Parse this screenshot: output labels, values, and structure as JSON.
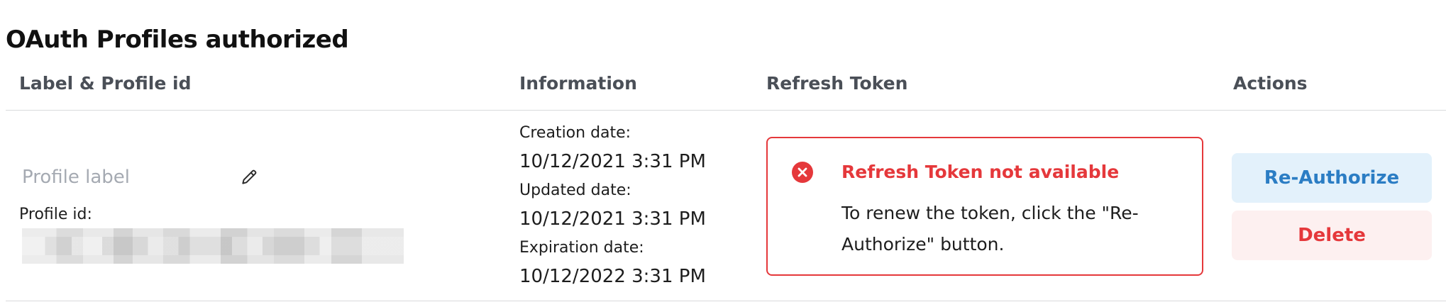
{
  "page": {
    "title": "OAuth Profiles authorized"
  },
  "table": {
    "headers": {
      "label": "Label & Profile id",
      "information": "Information",
      "refresh_token": "Refresh Token",
      "actions": "Actions"
    },
    "row": {
      "label_placeholder": "Profile label",
      "profile_id_label": "Profile id:",
      "profile_id_value": "",
      "info": {
        "creation_label": "Creation date:",
        "creation_value": "10/12/2021 3:31 PM",
        "updated_label": "Updated date:",
        "updated_value": "10/12/2021 3:31 PM",
        "expiration_label": "Expiration date:",
        "expiration_value": "10/12/2022 3:31 PM"
      },
      "refresh_token": {
        "icon": "error-circle-icon",
        "title": "Refresh Token not available",
        "message": "To renew the token, click the \"Re-Authorize\" button."
      },
      "actions": {
        "reauthorize_label": "Re-Authorize",
        "delete_label": "Delete"
      }
    }
  },
  "colors": {
    "error": "#e5383b",
    "primary": "#2b7dc4",
    "primary_bg": "#e3f1fb",
    "danger_bg": "#fdf0f0",
    "header_text": "#4a4f57",
    "placeholder": "#a5aab2"
  }
}
